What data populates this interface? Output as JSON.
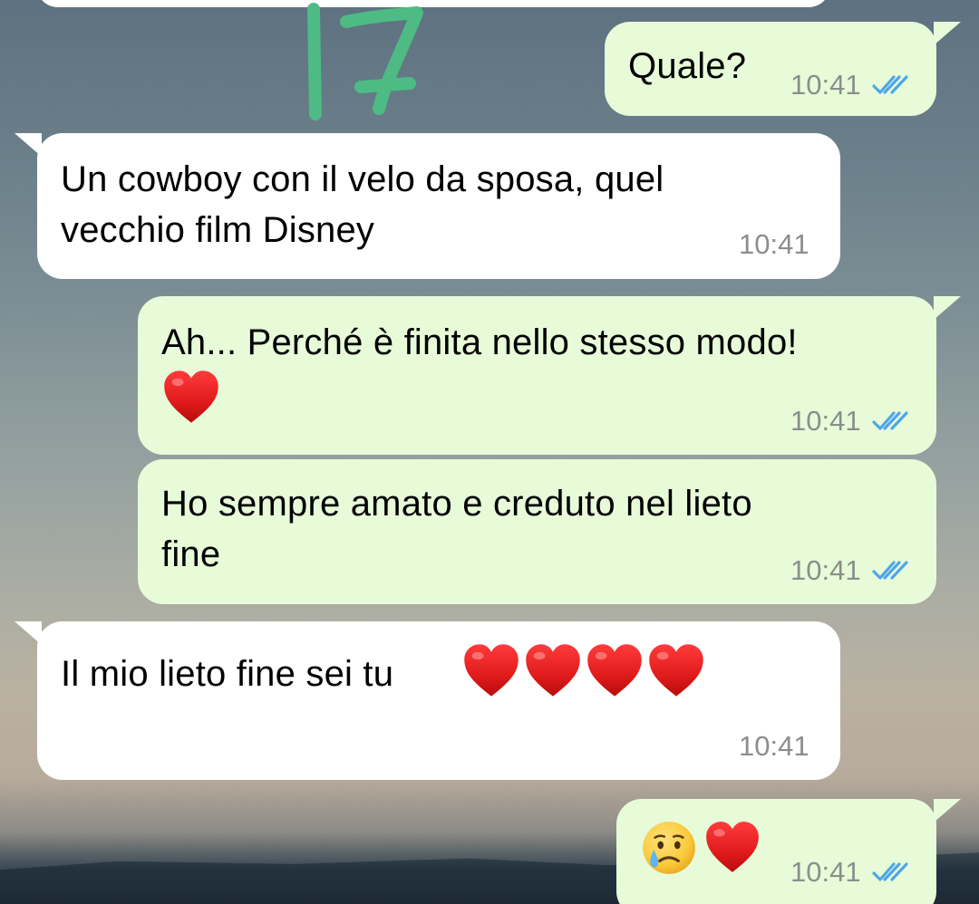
{
  "annotation": {
    "label": "17",
    "color": "#4dbb83"
  },
  "colors": {
    "outgoing_bubble": "#e7fbd9",
    "incoming_bubble": "#ffffff",
    "read_ticks": "#4fa6e8",
    "timestamp": "#8a8f8a"
  },
  "messages": [
    {
      "direction": "outgoing",
      "text": "Quale?",
      "time": "10:41",
      "status": "read"
    },
    {
      "direction": "incoming",
      "lines": [
        "Un cowboy con il velo da sposa, quel",
        "vecchio film Disney"
      ],
      "time": "10:41"
    },
    {
      "direction": "outgoing",
      "text": "Ah... Perché è finita nello stesso modo!",
      "emoji": [
        "heart-icon"
      ],
      "time": "10:41",
      "status": "read"
    },
    {
      "direction": "outgoing",
      "lines": [
        "Ho sempre amato e creduto nel lieto",
        "fine"
      ],
      "time": "10:41",
      "status": "read"
    },
    {
      "direction": "incoming",
      "text": "Il mio lieto fine sei tu",
      "emoji": [
        "heart-icon",
        "heart-icon",
        "heart-icon",
        "heart-icon"
      ],
      "time": "10:41"
    },
    {
      "direction": "outgoing",
      "emoji": [
        "crying-face-icon",
        "heart-icon"
      ],
      "time": "10:41",
      "status": "read"
    }
  ]
}
